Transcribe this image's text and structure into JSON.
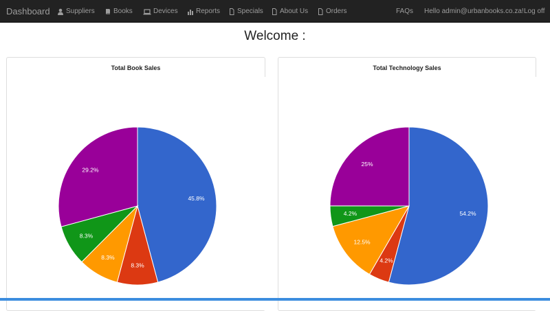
{
  "navbar": {
    "brand": "Dashboard",
    "items": [
      {
        "label": "Suppliers",
        "icon": "user-icon"
      },
      {
        "label": "Books",
        "icon": "book-icon"
      },
      {
        "label": "Devices",
        "icon": "laptop-icon"
      },
      {
        "label": "Reports",
        "icon": "bar-chart-icon"
      },
      {
        "label": "Specials",
        "icon": "file-icon"
      },
      {
        "label": "About Us",
        "icon": "file-icon"
      },
      {
        "label": "Orders",
        "icon": "file-icon"
      }
    ],
    "faqs": "FAQs",
    "greeting": "Hello admin@urbanbooks.co.za!",
    "logoff": "Log off"
  },
  "page": {
    "title": "Welcome :"
  },
  "panels": {
    "left": {
      "title": "Total Book Sales"
    },
    "right": {
      "title": "Total Technology Sales"
    }
  },
  "colors": {
    "blue": "#3366cc",
    "red": "#dc3912",
    "orange": "#ff9900",
    "green": "#109618",
    "purple": "#990099"
  },
  "chart_data": [
    {
      "type": "pie",
      "title": "Total Book Sales",
      "slices": [
        {
          "value": 45.8,
          "label": "45.8%",
          "color": "#3366cc"
        },
        {
          "value": 8.3,
          "label": "8.3%",
          "color": "#dc3912"
        },
        {
          "value": 8.3,
          "label": "8.3%",
          "color": "#ff9900"
        },
        {
          "value": 8.3,
          "label": "8.3%",
          "color": "#109618"
        },
        {
          "value": 29.2,
          "label": "29.2%",
          "color": "#990099"
        }
      ]
    },
    {
      "type": "pie",
      "title": "Total Technology Sales",
      "slices": [
        {
          "value": 54.2,
          "label": "54.2%",
          "color": "#3366cc"
        },
        {
          "value": 4.2,
          "label": "4.2%",
          "color": "#dc3912"
        },
        {
          "value": 12.5,
          "label": "12.5%",
          "color": "#ff9900"
        },
        {
          "value": 4.2,
          "label": "4.2%",
          "color": "#109618"
        },
        {
          "value": 25,
          "label": "25%",
          "color": "#990099"
        }
      ]
    }
  ]
}
